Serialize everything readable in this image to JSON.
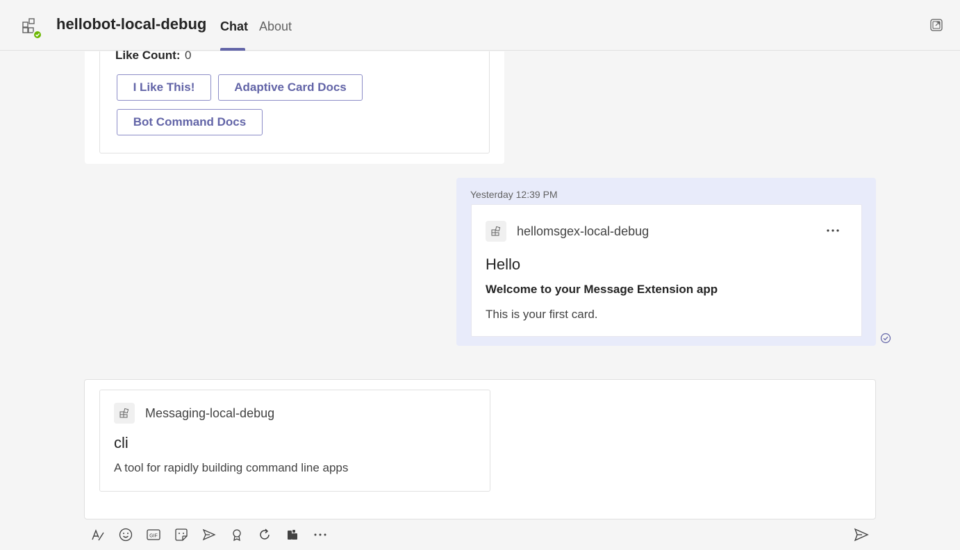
{
  "header": {
    "app_title": "hellobot-local-debug",
    "tabs": [
      {
        "label": "Chat",
        "active": true
      },
      {
        "label": "About",
        "active": false
      }
    ]
  },
  "top_card": {
    "like_label": "Like Count:",
    "like_value": "0",
    "buttons": [
      "I Like This!",
      "Adaptive Card Docs",
      "Bot Command Docs"
    ]
  },
  "sent_message": {
    "timestamp": "Yesterday 12:39 PM",
    "app_name": "hellomsgex-local-debug",
    "title": "Hello",
    "subtitle": "Welcome to your Message Extension app",
    "text": "This is your first card."
  },
  "compose_preview": {
    "app_name": "Messaging-local-debug",
    "title": "cli",
    "text": "A tool for rapidly building command line apps"
  },
  "toolbar": {
    "icons": [
      "format-icon",
      "emoji-icon",
      "gif-icon",
      "sticker-icon",
      "meet-now-icon",
      "praise-icon",
      "loop-icon",
      "apps-icon",
      "more-options-icon",
      "send-icon"
    ]
  },
  "colors": {
    "accent": "#6264a7",
    "bubble": "#e8ebfa",
    "presence": "#6bb700",
    "background": "#f5f5f5"
  }
}
